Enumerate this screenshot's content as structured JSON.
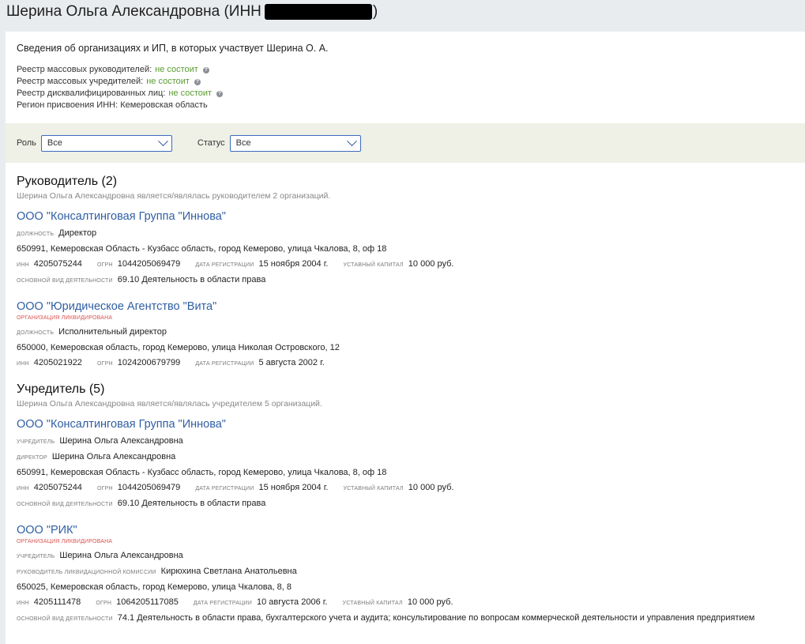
{
  "header": {
    "title_prefix": "Шерина Ольга Александровна (ИНН",
    "title_suffix": ")"
  },
  "intro": "Сведения об организациях и ИП, в которых участвует Шерина О. А.",
  "registries": [
    {
      "label": "Реестр массовых руководителей:",
      "value": "не состоит"
    },
    {
      "label": "Реестр массовых учредителей:",
      "value": "не состоит"
    },
    {
      "label": "Реестр дисквалифицированных лиц:",
      "value": "не состоит"
    }
  ],
  "region": "Регион присвоения ИНН: Кемеровская область",
  "filters": {
    "role_label": "Роль",
    "role_value": "Все",
    "status_label": "Статус",
    "status_value": "Все"
  },
  "labels": {
    "position": "должность",
    "inn": "ИНН",
    "ogrn": "ОГРН",
    "reg_date": "дата регистрации",
    "capital": "уставный капитал",
    "activity": "основной вид деятельности",
    "liquidated": "организация ликвидирована",
    "founder": "учредитель",
    "director": "директор",
    "liq_head": "руководитель ликвидационной комиссии"
  },
  "managers": {
    "title": "Руководитель (2)",
    "subtitle": "Шерина Ольга Александровна является/являлась руководителем 2 организаций.",
    "orgs": [
      {
        "name": "ООО \"Консалтинговая Группа \"Иннова\"",
        "position": "Директор",
        "address": "650991, Кемеровская Область - Кузбасс область, город Кемерово, улица Чкалова, 8, оф 18",
        "inn": "4205075244",
        "ogrn": "1044205069479",
        "reg_date": "15 ноября 2004 г.",
        "capital": "10 000 руб.",
        "activity": "69.10 Деятельность в области права"
      },
      {
        "name": "ООО \"Юридическое Агентство \"Вита\"",
        "position": "Исполнительный директор",
        "address": "650000, Кемеровская область, город Кемерово, улица Николая Островского, 12",
        "inn": "4205021922",
        "ogrn": "1024200679799",
        "reg_date": "5 августа 2002 г."
      }
    ]
  },
  "founders": {
    "title": "Учредитель (5)",
    "subtitle": "Шерина Ольга Александровна является/являлась учредителем 5 организаций.",
    "orgs": [
      {
        "name": "ООО \"Консалтинговая Группа \"Иннова\"",
        "founder": "Шерина Ольга Александровна",
        "director": "Шерина Ольга Александровна",
        "address": "650991, Кемеровская Область - Кузбасс область, город Кемерово, улица Чкалова, 8, оф 18",
        "inn": "4205075244",
        "ogrn": "1044205069479",
        "reg_date": "15 ноября 2004 г.",
        "capital": "10 000 руб.",
        "activity": "69.10 Деятельность в области права"
      },
      {
        "name": "ООО \"РИК\"",
        "founder": "Шерина Ольга Александровна",
        "liq_head": "Кирюхина Светлана Анатольевна",
        "address": "650025, Кемеровская область, город Кемерово, улица Чкалова, 8, 8",
        "inn": "4205111478",
        "ogrn": "1064205117085",
        "reg_date": "10 августа 2006 г.",
        "capital": "10 000 руб.",
        "activity": "74.1 Деятельность в области права, бухгалтерского учета и аудита; консультирование по вопросам коммерческой деятельности и управления предприятием"
      }
    ]
  }
}
